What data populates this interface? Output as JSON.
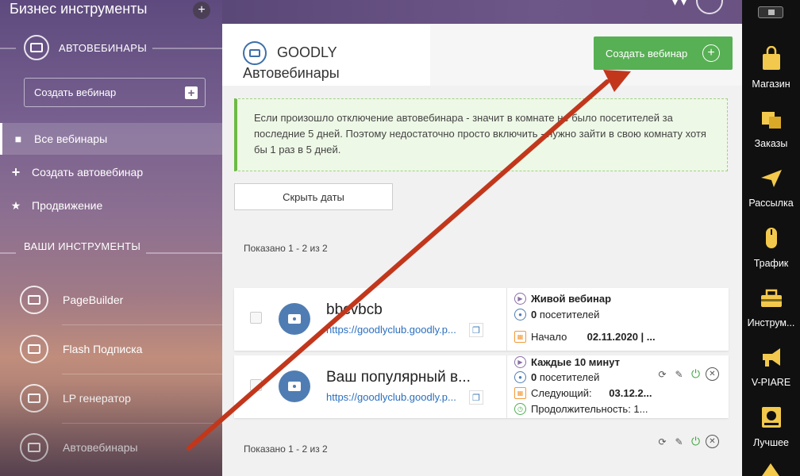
{
  "sidebar": {
    "title": "Бизнес инструменты",
    "section_label": "АВТОВЕБИНАРЫ",
    "create_webinar": "Создать вебинар",
    "menu": [
      {
        "label": "Все вебинары",
        "icon": "video-camera-icon"
      },
      {
        "label": "Создать автовебинар",
        "icon": "plus-icon"
      },
      {
        "label": "Продвижение",
        "icon": "star-icon"
      }
    ],
    "tools_heading": "ВАШИ ИНСТРУМЕНТЫ",
    "tools": [
      {
        "label": "PageBuilder",
        "icon": "pagebuilder-icon"
      },
      {
        "label": "Flash Подписка",
        "icon": "flash-subscription-icon"
      },
      {
        "label": "LP генератор",
        "icon": "lp-generator-icon"
      },
      {
        "label": "Автовебинары",
        "icon": "autowebinar-icon"
      }
    ]
  },
  "header": {
    "brand": "GOODLY",
    "subtitle": "Автовебинары",
    "create_button": "Создать вебинар"
  },
  "notice": {
    "text": "Если произошло отключение автовебинара - значит в комнате не было посетителей за последние 5 дней. Поэтому недостаточно просто включить - нужно зайти в свою комнату хотя бы 1 раз в 5 дней."
  },
  "hide_dates_button": "Скрыть даты",
  "shown_top": "Показано 1 - 2 из 2",
  "shown_bottom": "Показано 1 - 2 из 2",
  "webinars": [
    {
      "name": "bbcvbcb",
      "link": "https://goodlyclub.goodly.p...",
      "type": "Живой вебинар",
      "visitors_count": "0",
      "visitors_label": "посетителей",
      "date_label": "Начало",
      "date_value": "02.11.2020 | ..."
    },
    {
      "name": "Ваш популярный в...",
      "link": "https://goodlyclub.goodly.p...",
      "type": "Каждые 10 минут",
      "visitors_count": "0",
      "visitors_label": "посетителей",
      "date_label": "Следующий:",
      "date_value": "03.12.2...",
      "duration_label": "Продолжительность: 1..."
    }
  ],
  "dock": [
    {
      "label": "Магазин",
      "icon": "shopping-bag-icon",
      "color": "#f2c94c"
    },
    {
      "label": "Заказы",
      "icon": "orders-box-icon",
      "color": "#f2c94c"
    },
    {
      "label": "Рассылка",
      "icon": "paper-plane-icon",
      "color": "#f2c94c"
    },
    {
      "label": "Трафик",
      "icon": "mouse-icon",
      "color": "#f2c94c"
    },
    {
      "label": "Инструм...",
      "icon": "toolbox-icon",
      "color": "#f2c94c"
    },
    {
      "label": "V-PIARE",
      "icon": "megaphone-icon",
      "color": "#f2c94c"
    },
    {
      "label": "Лучшее",
      "icon": "best-badge-icon",
      "color": "#f2c94c"
    }
  ],
  "colors": {
    "accent_green": "#57b054",
    "link_blue": "#2a6fc0",
    "arrow_red": "#c2371c"
  }
}
